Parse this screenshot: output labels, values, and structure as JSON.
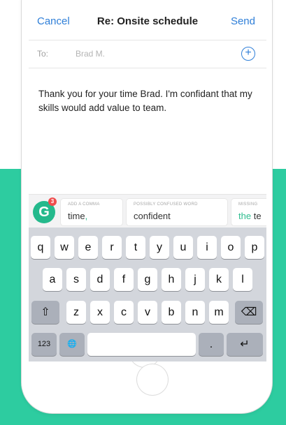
{
  "nav": {
    "cancel_label": "Cancel",
    "title": "Re: Onsite schedule",
    "send_label": "Send"
  },
  "to_row": {
    "label": "To:",
    "recipient": "Brad M.",
    "add_icon": "plus-circle-icon"
  },
  "message": {
    "body": "Thank you for your time Brad. I'm confidant that my skills would add value to team."
  },
  "grammarly": {
    "logo_letter": "G",
    "badge_count": "3",
    "suggestions": [
      {
        "caption": "ADD A COMMA",
        "word_before": "time",
        "highlight": ","
      },
      {
        "caption": "POSSIBLY CONFUSED WORD",
        "word_before": "",
        "highlight": "confident"
      },
      {
        "caption": "MISSING",
        "word_before": "",
        "highlight": "the",
        "word_after": "te"
      }
    ]
  },
  "keyboard": {
    "row1": [
      "q",
      "w",
      "e",
      "r",
      "t",
      "y",
      "u",
      "i",
      "o",
      "p"
    ],
    "row2": [
      "a",
      "s",
      "d",
      "f",
      "g",
      "h",
      "j",
      "k",
      "l"
    ],
    "row3": [
      "z",
      "x",
      "c",
      "v",
      "b",
      "n",
      "m"
    ],
    "shift_icon": "⇧",
    "delete_icon": "⌫",
    "numbers_label": "123",
    "globe_icon": "🌐",
    "period_label": ".",
    "return_icon": "↵"
  },
  "colors": {
    "accent": "#2f7fd8",
    "brand_green": "#2dcca0",
    "badge_red": "#ef4d4d"
  }
}
